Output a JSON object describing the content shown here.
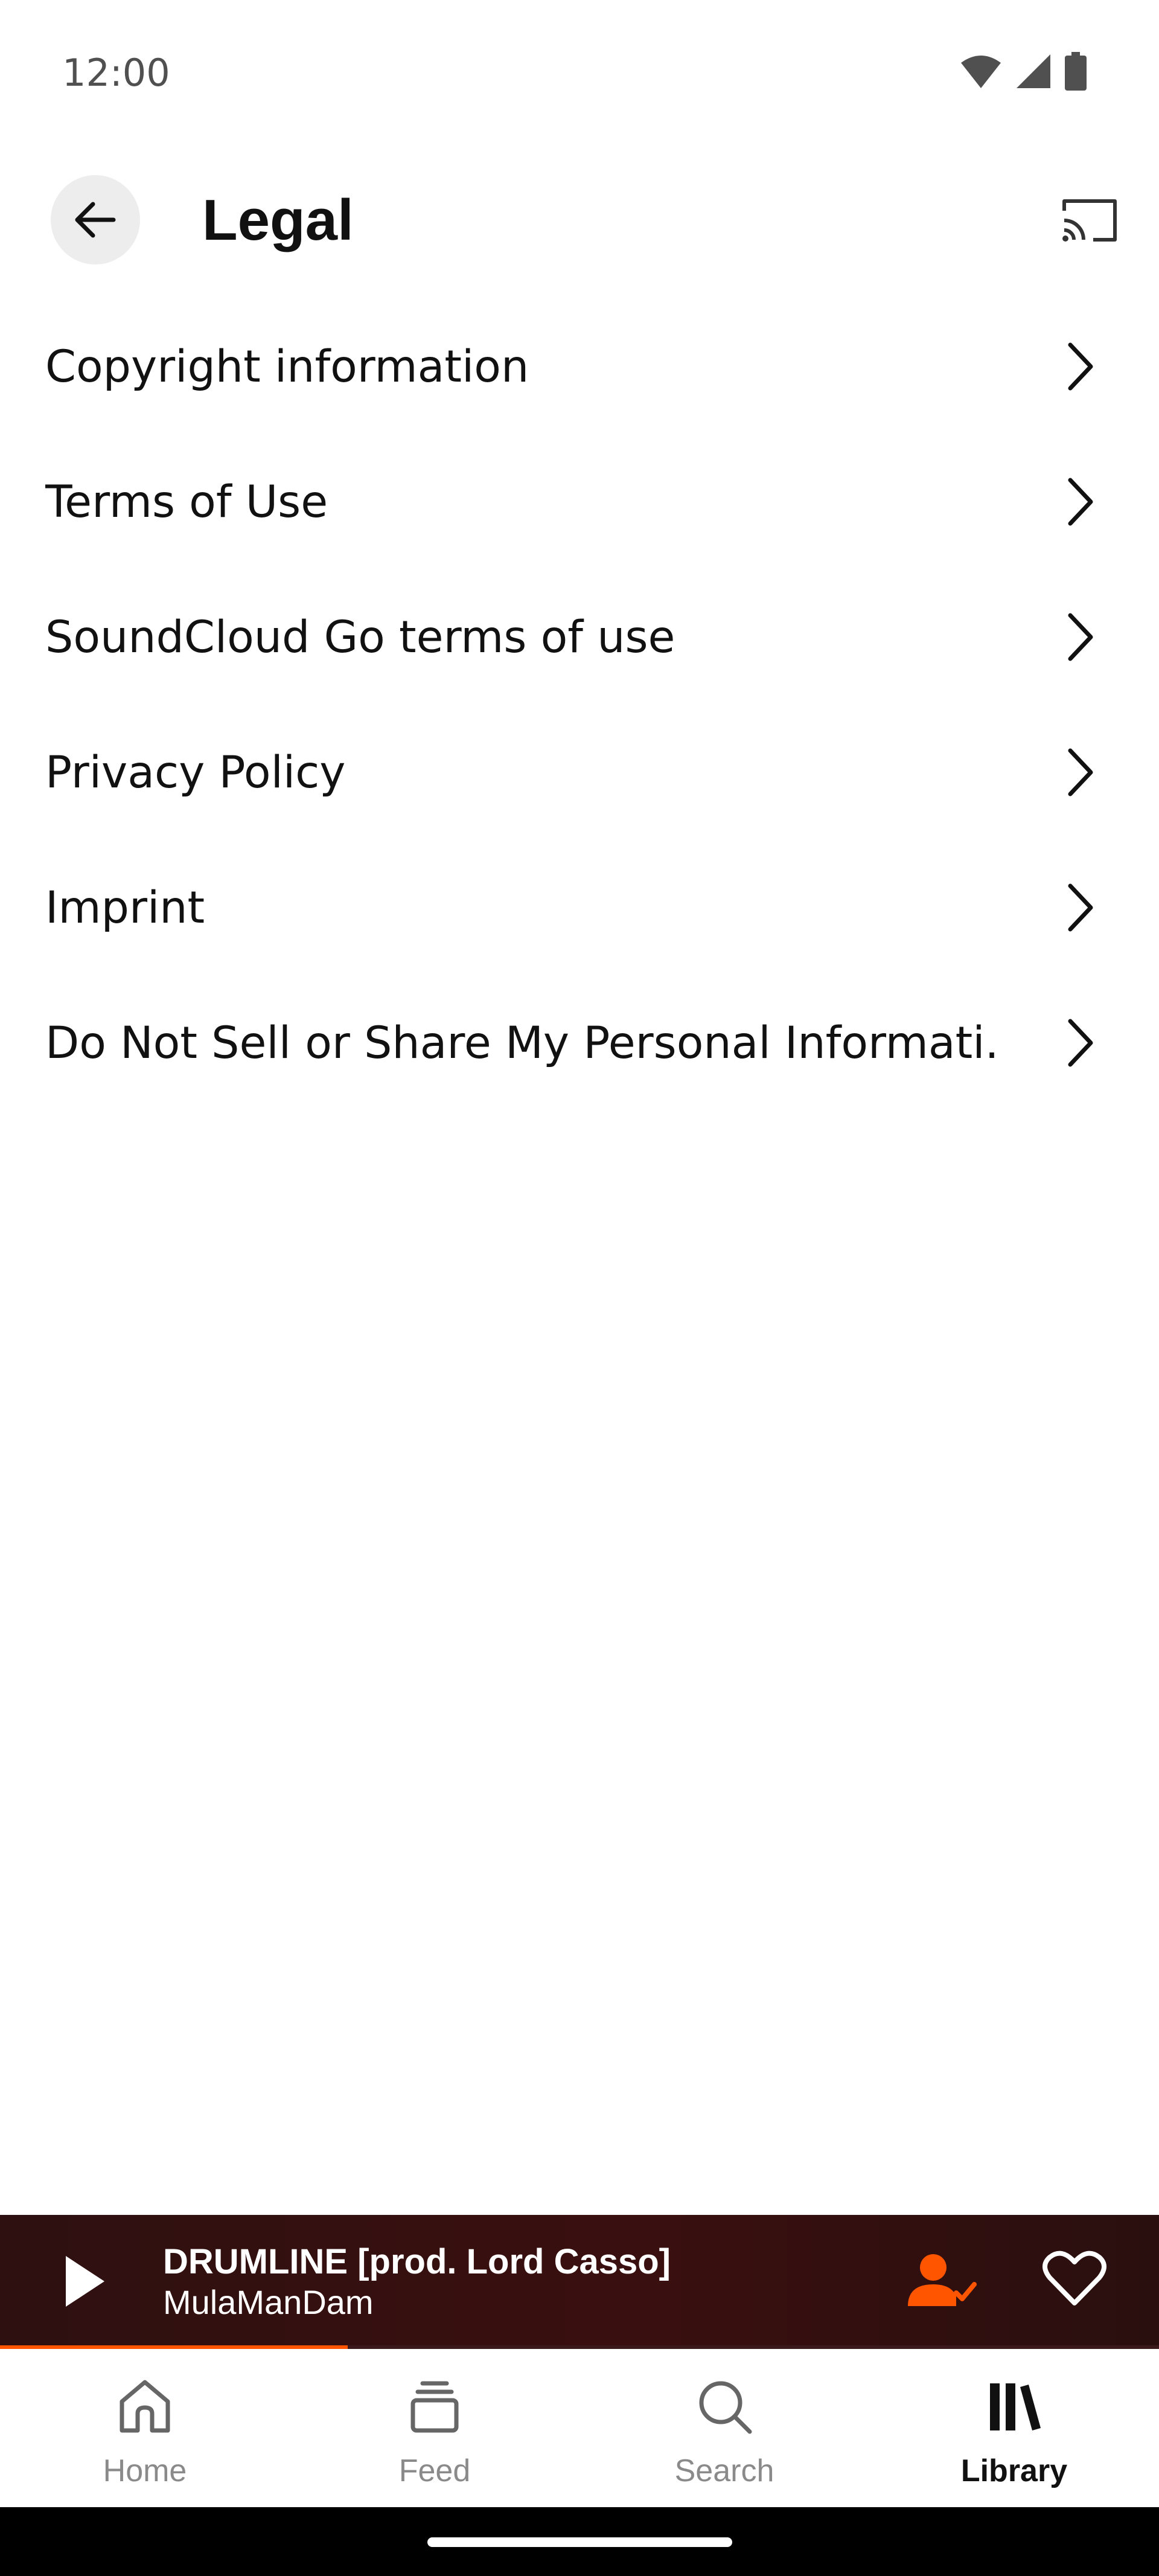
{
  "status_bar": {
    "time": "12:00"
  },
  "header": {
    "title": "Legal"
  },
  "menu": {
    "items": [
      {
        "label": "Copyright information"
      },
      {
        "label": "Terms of Use"
      },
      {
        "label": "SoundCloud Go terms of use"
      },
      {
        "label": "Privacy Policy"
      },
      {
        "label": "Imprint"
      },
      {
        "label": "Do Not Sell or Share My Personal Informati..."
      }
    ]
  },
  "player": {
    "title": "DRUMLINE [prod. Lord Casso]",
    "artist": "MulaManDam",
    "progress": 0.3,
    "accent_color": "#ff5500"
  },
  "nav": {
    "tabs": [
      {
        "label": "Home",
        "icon": "home-icon"
      },
      {
        "label": "Feed",
        "icon": "feed-icon"
      },
      {
        "label": "Search",
        "icon": "search-icon"
      },
      {
        "label": "Library",
        "icon": "library-icon",
        "active": true
      }
    ]
  }
}
